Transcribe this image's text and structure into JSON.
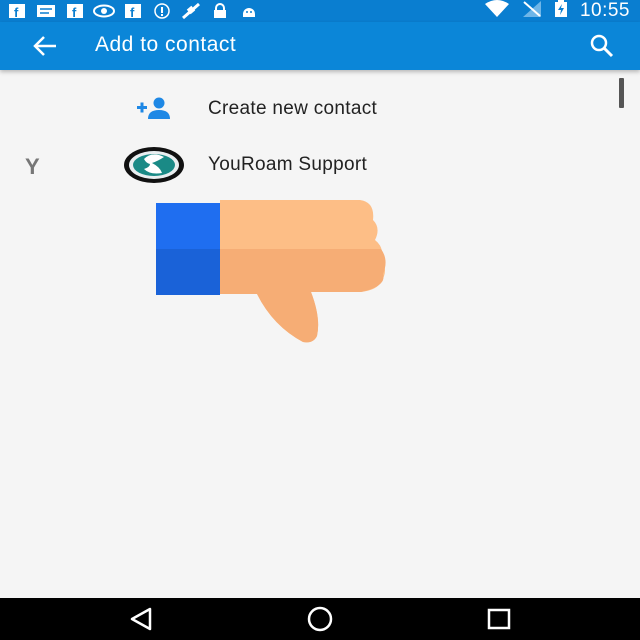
{
  "status_bar": {
    "time": "10:55",
    "icons_left": [
      "facebook-icon",
      "message-icon",
      "facebook-icon",
      "eye-icon",
      "facebook-icon",
      "info-icon",
      "satellite-icon",
      "lock-icon",
      "android-icon"
    ],
    "icons_right": [
      "wifi-icon",
      "no-signal-icon",
      "battery-charging-icon"
    ]
  },
  "app_bar": {
    "title": "Add to contact",
    "color": "#0b86d8"
  },
  "list": {
    "create_label": "Create new contact",
    "section_letter": "Y",
    "contact_name": "YouRoam Support"
  },
  "overlay": {
    "icon": "thumbs-down-icon"
  }
}
